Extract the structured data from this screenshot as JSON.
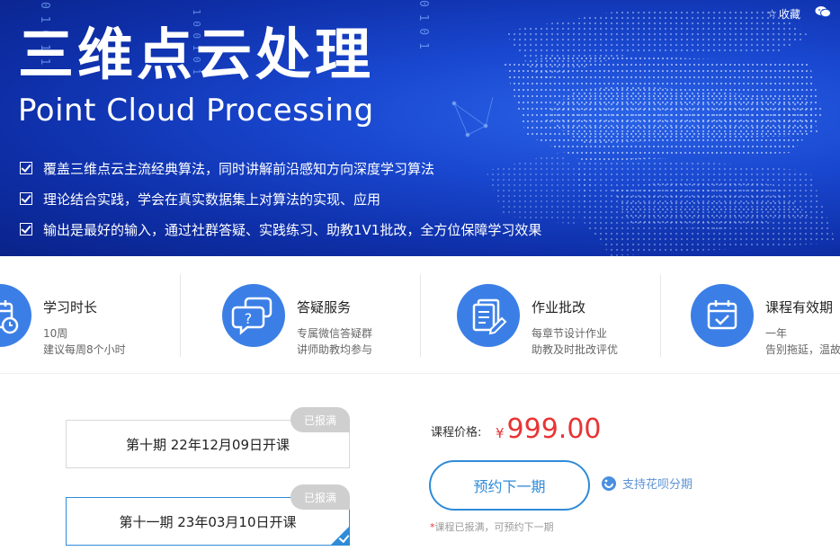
{
  "banner": {
    "title": "三维点云处理",
    "subtitle": "Point Cloud Processing",
    "features": [
      "覆盖三维点云主流经典算法，同时讲解前沿感知方向深度学习算法",
      "理论结合实践，学会在真实数据集上对算法的实现、应用",
      "输出是最好的输入，通过社群答疑、实践练习、助教1V1批改，全方位保障学习效果"
    ],
    "favorite_label": "收藏",
    "binary_text": [
      "0 1 0 1 1",
      "0 1 0 1",
      "1 0 0 1 0 1"
    ]
  },
  "info": [
    {
      "icon": "calendar-clock-icon",
      "title": "学习时长",
      "lines": [
        "10周",
        "建议每周8个小时"
      ]
    },
    {
      "icon": "qa-chat-icon",
      "title": "答疑服务",
      "lines": [
        "专属微信答疑群",
        "讲师助教均参与"
      ]
    },
    {
      "icon": "homework-edit-icon",
      "title": "作业批改",
      "lines": [
        "每章节设计作业",
        "助教及时批改评优"
      ]
    },
    {
      "icon": "calendar-check-icon",
      "title": "课程有效期",
      "lines": [
        "一年",
        "告别拖延，温故知新"
      ]
    }
  ],
  "sessions": [
    {
      "label": "第十期 22年12月09日开课",
      "tag": "已报满",
      "selected": false
    },
    {
      "label": "第十一期 23年03月10日开课",
      "tag": "已报满",
      "selected": true
    }
  ],
  "pricing": {
    "label": "课程价格:",
    "currency": "¥",
    "amount": "999.00",
    "reserve_button": "预约下一期",
    "huabei_label": "支持花呗分期",
    "notice_star": "*",
    "notice": "课程已报满，可预约下一期"
  },
  "colors": {
    "accent": "#2f8bd8",
    "price": "#e83434",
    "banner_dark": "#0e2fa8",
    "icon_circle": "#3b7fe6"
  }
}
